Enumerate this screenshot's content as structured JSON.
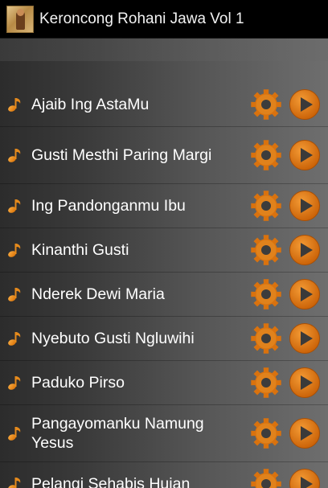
{
  "app": {
    "title": "Keroncong Rohani Jawa Vol 1",
    "accent_color": "#e07a10"
  },
  "songs": [
    {
      "title": "Ajaib Ing AstaMu"
    },
    {
      "title": "Gusti Mesthi Paring Margi"
    },
    {
      "title": "Ing Pandonganmu Ibu"
    },
    {
      "title": "Kinanthi Gusti"
    },
    {
      "title": "Nderek Dewi Maria"
    },
    {
      "title": "Nyebuto Gusti Ngluwihi"
    },
    {
      "title": "Paduko Pirso"
    },
    {
      "title": "Pangayomanku Namung Yesus"
    },
    {
      "title": "Pelangi Sehabis Hujan"
    }
  ],
  "icons": {
    "list_item": "music-note-icon",
    "settings": "gear-icon",
    "play": "play-icon"
  }
}
